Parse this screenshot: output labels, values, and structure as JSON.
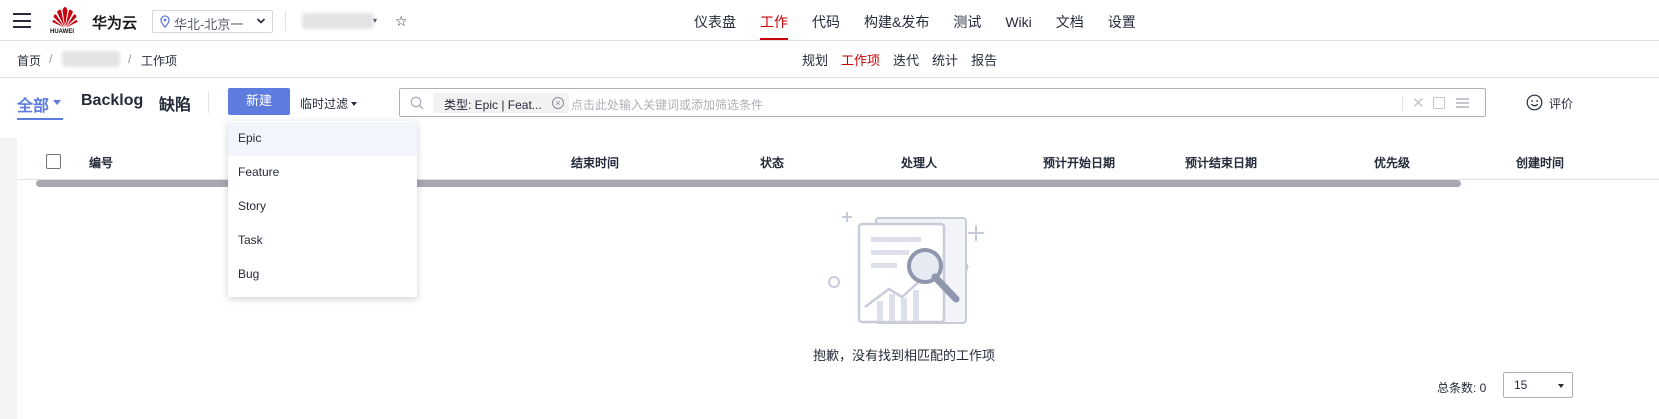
{
  "topbar": {
    "brand": "华为云",
    "logo_text": "HUAWEI",
    "region": "华北-北京一",
    "nav": [
      {
        "label": "仪表盘",
        "active": false
      },
      {
        "label": "工作",
        "active": true
      },
      {
        "label": "代码",
        "active": false
      },
      {
        "label": "构建&发布",
        "active": false
      },
      {
        "label": "测试",
        "active": false
      },
      {
        "label": "Wiki",
        "active": false
      },
      {
        "label": "文档",
        "active": false
      },
      {
        "label": "设置",
        "active": false
      }
    ]
  },
  "breadcrumb": {
    "home": "首页",
    "sep1": "/",
    "sep2": "/",
    "current": "工作项"
  },
  "subnav": [
    {
      "label": "规划",
      "active": false
    },
    {
      "label": "工作项",
      "active": true
    },
    {
      "label": "迭代",
      "active": false
    },
    {
      "label": "统计",
      "active": false
    },
    {
      "label": "报告",
      "active": false
    }
  ],
  "toolbar": {
    "tab_all": "全部",
    "tab_backlog": "Backlog",
    "tab_defect": "缺陷",
    "new_button": "新建",
    "temp_filter": "临时过滤",
    "filter_chip": "类型: Epic | Feat...",
    "search_placeholder": "点击此处输入关键词或添加筛选条件",
    "rate_label": "评价"
  },
  "table": {
    "columns": [
      "编号",
      "结束时间",
      "状态",
      "处理人",
      "预计开始日期",
      "预计结束日期",
      "优先级",
      "创建时间"
    ]
  },
  "empty_state": {
    "message": "抱歉，没有找到相匹配的工作项"
  },
  "pagination": {
    "total_label": "总条数: 0",
    "page_size": "15"
  },
  "new_dropdown": {
    "options": [
      "Epic",
      "Feature",
      "Story",
      "Task",
      "Bug"
    ]
  },
  "colors": {
    "accent": "#5e7ce0",
    "brand_red": "#c7000b"
  },
  "icons": {
    "menu": "hamburger-icon",
    "location": "location-pin-icon",
    "favorite": "star-icon",
    "search": "search-icon",
    "clear": "close-icon",
    "save": "save-icon",
    "list": "list-icon",
    "feedback": "smile-icon"
  }
}
